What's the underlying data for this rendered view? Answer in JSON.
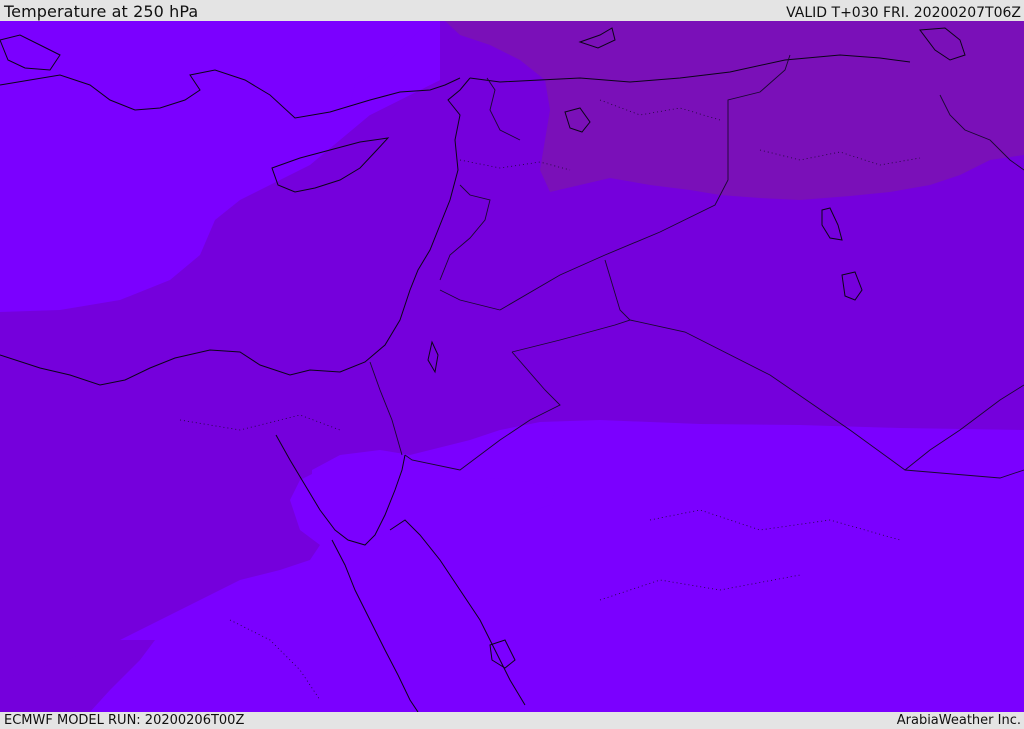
{
  "header": {
    "title": "Temperature at 250 hPa",
    "valid_time": "VALID T+030 FRI. 20200207T06Z"
  },
  "footer": {
    "model_run": "ECMWF MODEL RUN: 20200206T00Z",
    "credit": "ArabiaWeather Inc."
  },
  "map": {
    "field": "temperature-250hPa",
    "colors": {
      "band_light": "#7b00ff",
      "band_mid": "#7500dc",
      "band_dark": "#7a10b8",
      "coast": "#0c0418",
      "border": "#1a0830"
    }
  }
}
